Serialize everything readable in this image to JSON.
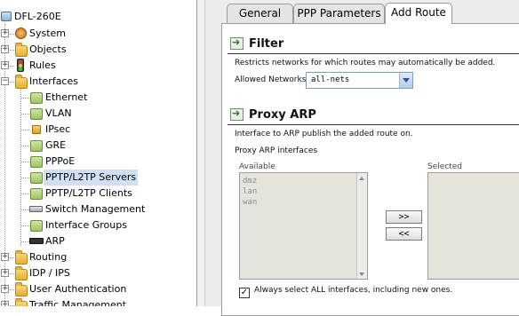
{
  "tree": {
    "root": "DFL-260E",
    "items": [
      {
        "label": "System",
        "icon": "system-gear-icon"
      },
      {
        "label": "Objects",
        "icon": "folder-icon"
      },
      {
        "label": "Rules",
        "icon": "traffic-light-icon"
      },
      {
        "label": "Interfaces",
        "icon": "folder-icon"
      },
      {
        "label": "Ethernet",
        "icon": "ethernet-icon"
      },
      {
        "label": "VLAN",
        "icon": "vlan-icon"
      },
      {
        "label": "IPsec",
        "icon": "lock-icon"
      },
      {
        "label": "GRE",
        "icon": "gre-icon"
      },
      {
        "label": "PPPoE",
        "icon": "pppoe-icon"
      },
      {
        "label": "PPTP/L2TP Servers",
        "icon": "pptp-server-icon"
      },
      {
        "label": "PPTP/L2TP Clients",
        "icon": "pptp-client-icon"
      },
      {
        "label": "Switch Management",
        "icon": "switch-icon"
      },
      {
        "label": "Interface Groups",
        "icon": "interface-group-icon"
      },
      {
        "label": "ARP",
        "icon": "arp-chip-icon"
      },
      {
        "label": "Routing",
        "icon": "folder-icon"
      },
      {
        "label": "IDP / IPS",
        "icon": "folder-icon"
      },
      {
        "label": "User Authentication",
        "icon": "user-auth-icon"
      },
      {
        "label": "Traffic Management",
        "icon": "folder-icon"
      }
    ]
  },
  "tabs": [
    {
      "label": "General"
    },
    {
      "label": "PPP Parameters"
    },
    {
      "label": "Add Route"
    }
  ],
  "filter": {
    "title": "Filter",
    "description": "Restricts networks for which routes may automatically be added.",
    "allowed_label": "Allowed Networks:",
    "allowed_value": "all-nets"
  },
  "proxy_arp": {
    "title": "Proxy ARP",
    "description": "Interface to ARP publish the added route on.",
    "interfaces_label": "Proxy ARP interfaces",
    "available_label": "Available",
    "selected_label": "Selected",
    "available": [
      "dmz",
      "lan",
      "wan"
    ],
    "add_label": ">>",
    "remove_label": "<<",
    "checkbox_label": "Always select ALL interfaces, including new ones.",
    "checkbox_mark": "✓"
  }
}
